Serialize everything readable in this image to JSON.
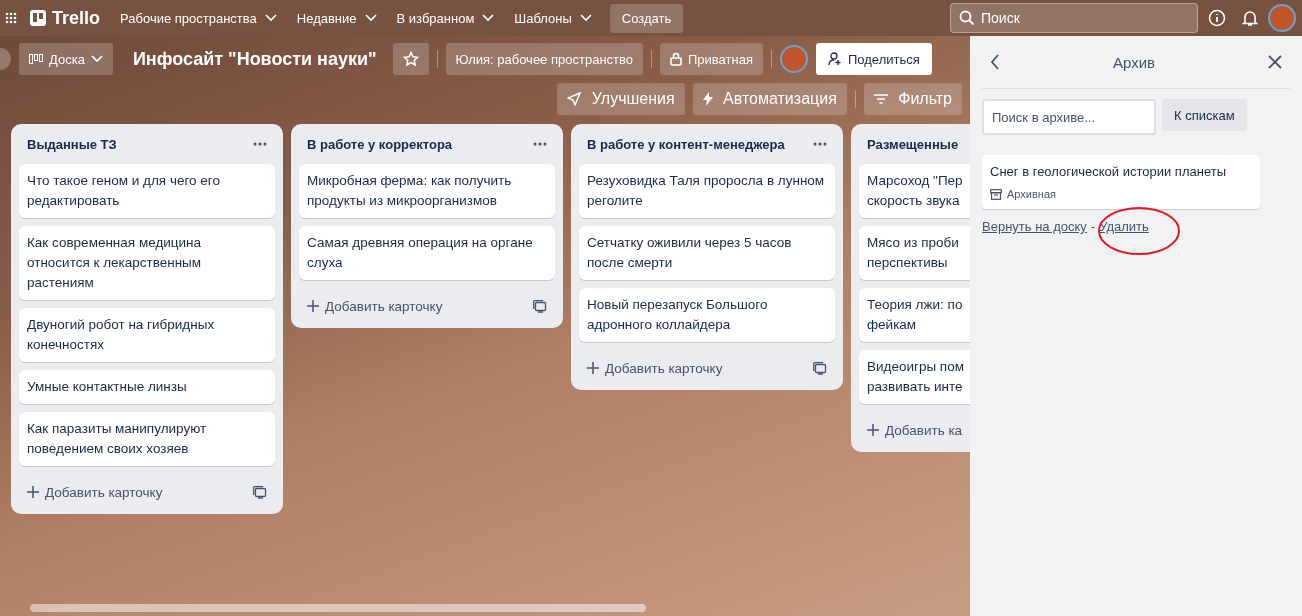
{
  "topbar": {
    "logo": "Trello",
    "menus": [
      "Рабочие пространства",
      "Недавние",
      "В избранном",
      "Шаблоны"
    ],
    "create": "Создать",
    "search": {
      "placeholder": "Поиск"
    }
  },
  "board_header": {
    "view": "Доска",
    "title": "Инфосайт \"Новости науки\"",
    "starred": false,
    "workspace": "Юлия: рабочее пространство",
    "visibility": "Приватная",
    "share": "Поделиться",
    "actions": [
      "Улучшения",
      "Автоматизация",
      "Фильтр"
    ]
  },
  "lists": [
    {
      "title": "Выданные ТЗ",
      "cards": [
        "Что такое геном и для чего его редактировать",
        "Как современная медицина относится к лекарственным растениям",
        "Двуногий робот на гибридных конечностях",
        "Умные контактные линзы",
        "Как паразиты манипулируют поведением своих хозяев"
      ],
      "add": "Добавить карточку"
    },
    {
      "title": "В работе у корректора",
      "cards": [
        "Микробная ферма: как получить продукты из микроорганизмов",
        "Самая древняя операция на органе слуха"
      ],
      "add": "Добавить карточку"
    },
    {
      "title": "В работе у контент-менеджера",
      "cards": [
        "Резуховидка Таля проросла в лунном реголите",
        "Сетчатку оживили через 5 часов после смерти",
        "Новый перезапуск Большого адронного коллайдера"
      ],
      "add": "Добавить карточку"
    },
    {
      "title": "Размещенные",
      "cards": [
        "Марсоход \"Пер\nскорость звука",
        "Мясо из проби\nперспективы",
        "Теория лжи: по\nфейкам",
        "Видеоигры пом\nразвивать инте"
      ],
      "add": "Добавить ка"
    }
  ],
  "archive": {
    "title": "Архив",
    "search": {
      "placeholder": "Поиск в архиве..."
    },
    "switch": "К спискам",
    "cards": [
      {
        "text": "Снег в геологической истории планеты",
        "badge": "Архивная",
        "restore": "Вернуть на доску",
        "separator": "-",
        "delete": "Удалить"
      }
    ]
  }
}
